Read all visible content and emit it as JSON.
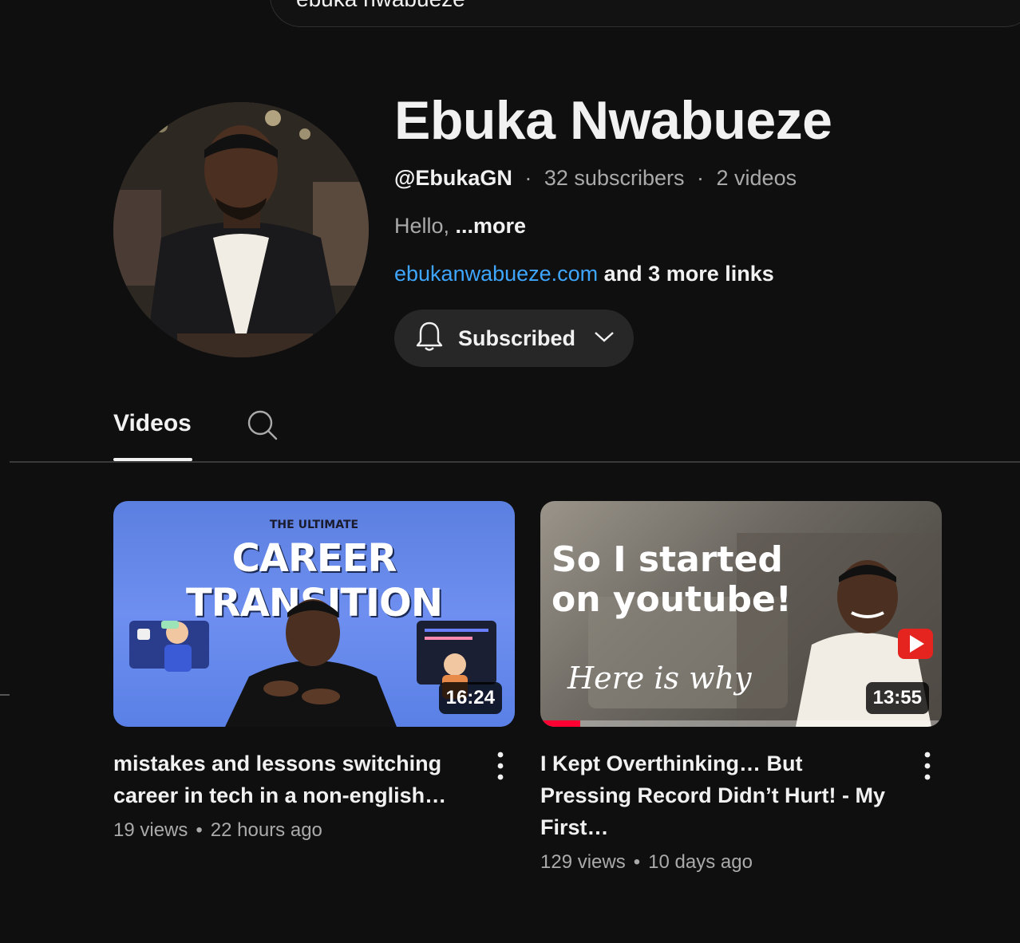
{
  "search": {
    "query": "ebuka nwabueze"
  },
  "channel": {
    "name": "Ebuka Nwabueze",
    "handle": "@EbukaGN",
    "subscribers": "32 subscribers",
    "video_count": "2 videos",
    "meta_separator": "·",
    "description": "Hello, ",
    "description_more": "...more",
    "link": "ebukanwabueze.com",
    "more_links": " and 3 more links"
  },
  "subscribe_button": {
    "label": "Subscribed"
  },
  "tabs": {
    "videos": "Videos"
  },
  "videos": [
    {
      "thumbnail_small": "THE ULTIMATE",
      "thumbnail_big": "CAREER TRANSITION",
      "duration": "16:24",
      "title": "mistakes and lessons switching career in tech in a non-english…",
      "views": "19 views",
      "age": "22 hours ago"
    },
    {
      "thumbnail_line1": "So I started",
      "thumbnail_line2": "on youtube!",
      "thumbnail_script": "Here is why",
      "duration": "13:55",
      "title": "I Kept Overthinking… But Pressing Record Didn’t Hurt! - My First…",
      "views": "129 views",
      "age": "10 days ago",
      "watch_progress": 0.1
    }
  ],
  "stats_separator": "•",
  "colors": {
    "background": "#0f0f0f",
    "link": "#3ea6ff",
    "progress": "#ff0033",
    "button_bg": "#272727"
  }
}
